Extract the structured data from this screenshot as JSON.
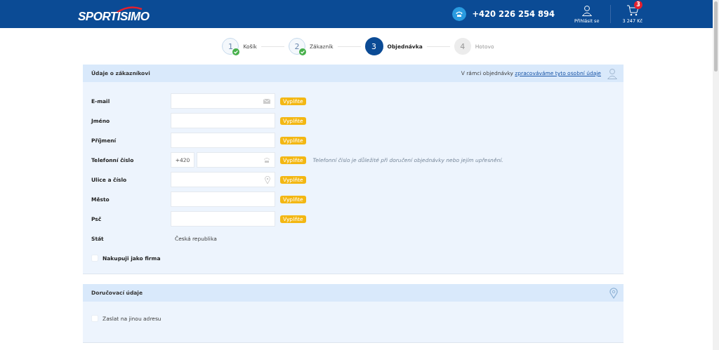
{
  "header": {
    "logo": "SPORTISIMO",
    "phone": "+420 226 254 894",
    "login": "Přihlásit se",
    "cart_count": "3",
    "cart_total": "3 247 Kč"
  },
  "steps": [
    {
      "number": "1",
      "label": "Košík",
      "done": true,
      "selected": false
    },
    {
      "number": "2",
      "label": "Zákazník",
      "done": true,
      "selected": false
    },
    {
      "number": "3",
      "label": "Objednávka",
      "done": false,
      "selected": true
    },
    {
      "number": "4",
      "label": "Hotovo",
      "done": false,
      "selected": false
    }
  ],
  "customer": {
    "title": "Údaje o zákazníkovi",
    "note": "V rámci objednávky",
    "note_link": "zpracováváme tyto osobní údaje",
    "fields": [
      {
        "label": "E-mail",
        "kind": "email",
        "badge": "Vyplňte"
      },
      {
        "label": "Jméno",
        "kind": "text",
        "badge": "Vyplňte"
      },
      {
        "label": "Příjmení",
        "kind": "text",
        "badge": "Vyplňte"
      },
      {
        "label": "Telefonní číslo",
        "kind": "phone",
        "prefix": "+420",
        "badge": "Vyplňte",
        "hint": "Telefonní číslo je důležité při doručení objednávky nebo jejím upřesnění."
      },
      {
        "label": "Ulice a číslo",
        "kind": "street",
        "badge": "Vyplňte"
      },
      {
        "label": "Město",
        "kind": "text",
        "badge": "Vyplňte"
      },
      {
        "label": "Psč",
        "kind": "text",
        "badge": "Vyplňte"
      },
      {
        "label": "Stát",
        "kind": "static",
        "value": "Česká republika"
      }
    ],
    "company_checkbox": {
      "label": "Nakupuji jako firma",
      "checked": false
    }
  },
  "delivery": {
    "title": "Doručovací údaje",
    "checkbox": {
      "label": "Zaslat na jinou adresu",
      "checked": false
    }
  }
}
